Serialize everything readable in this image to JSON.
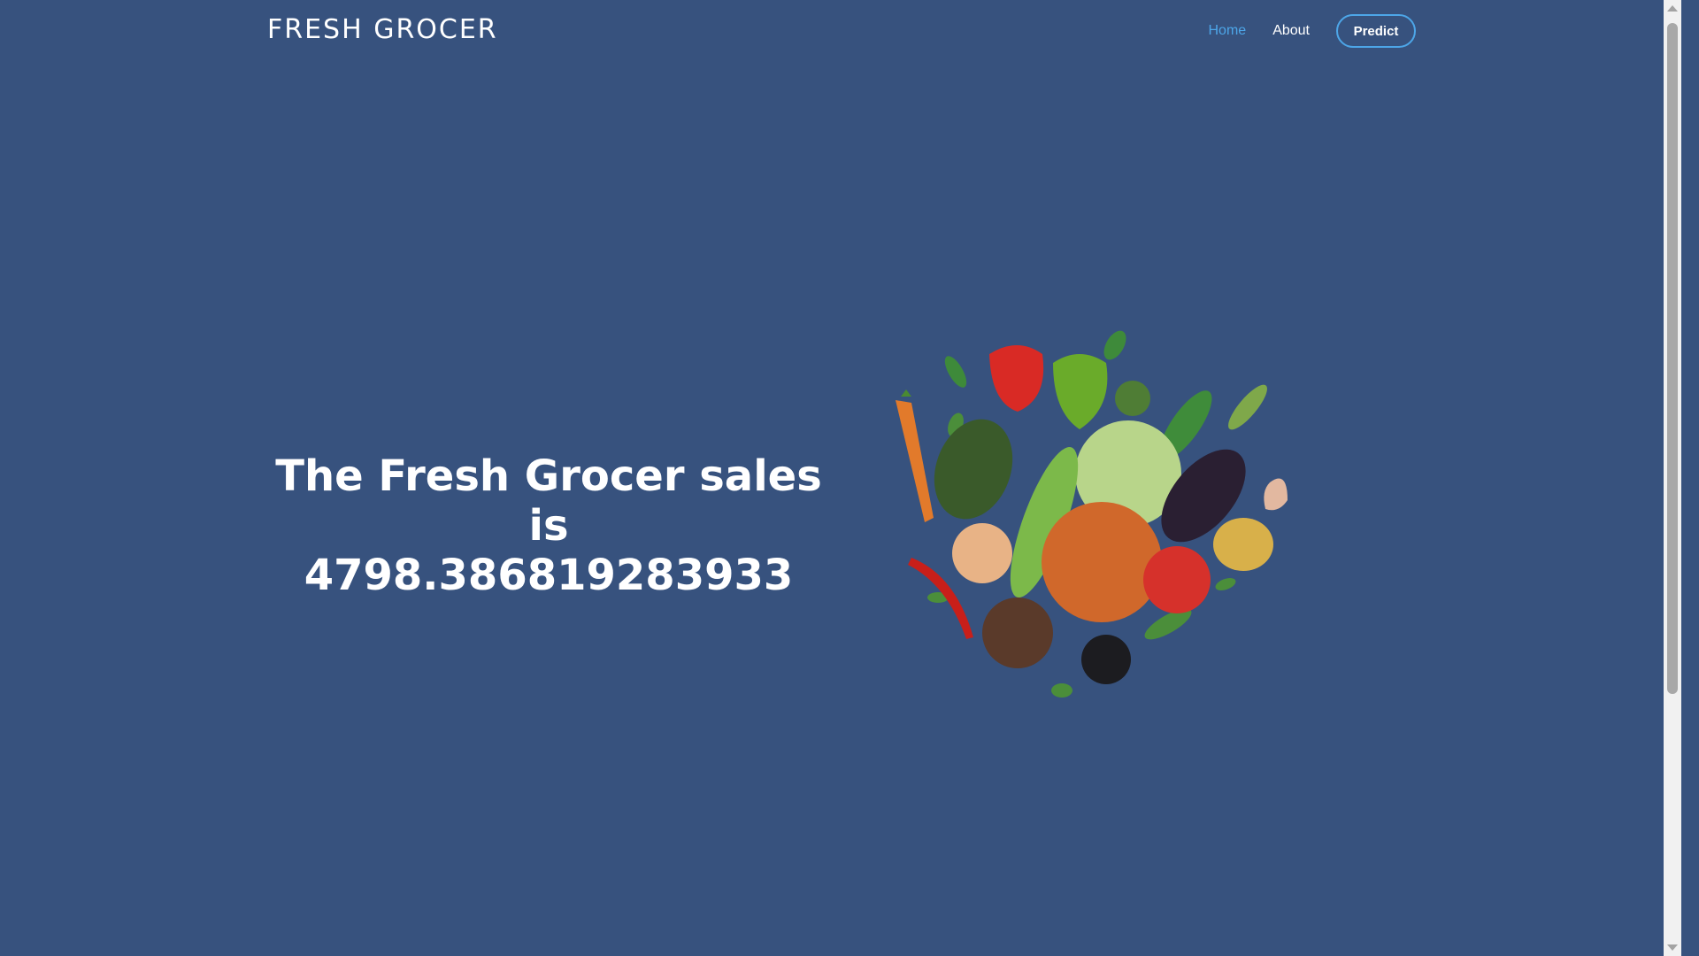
{
  "nav": {
    "brand": "FRESH GROCER",
    "links": [
      {
        "label": "Home",
        "active": true
      },
      {
        "label": "About",
        "active": false
      }
    ],
    "predict_label": "Predict"
  },
  "hero": {
    "line1": "The Fresh Grocer sales is",
    "line2": "4798.386819283933"
  },
  "image": {
    "icon": "vegetables-illustration"
  },
  "colors": {
    "background": "#37527e",
    "accent": "#4da6e8",
    "text": "#ffffff"
  }
}
